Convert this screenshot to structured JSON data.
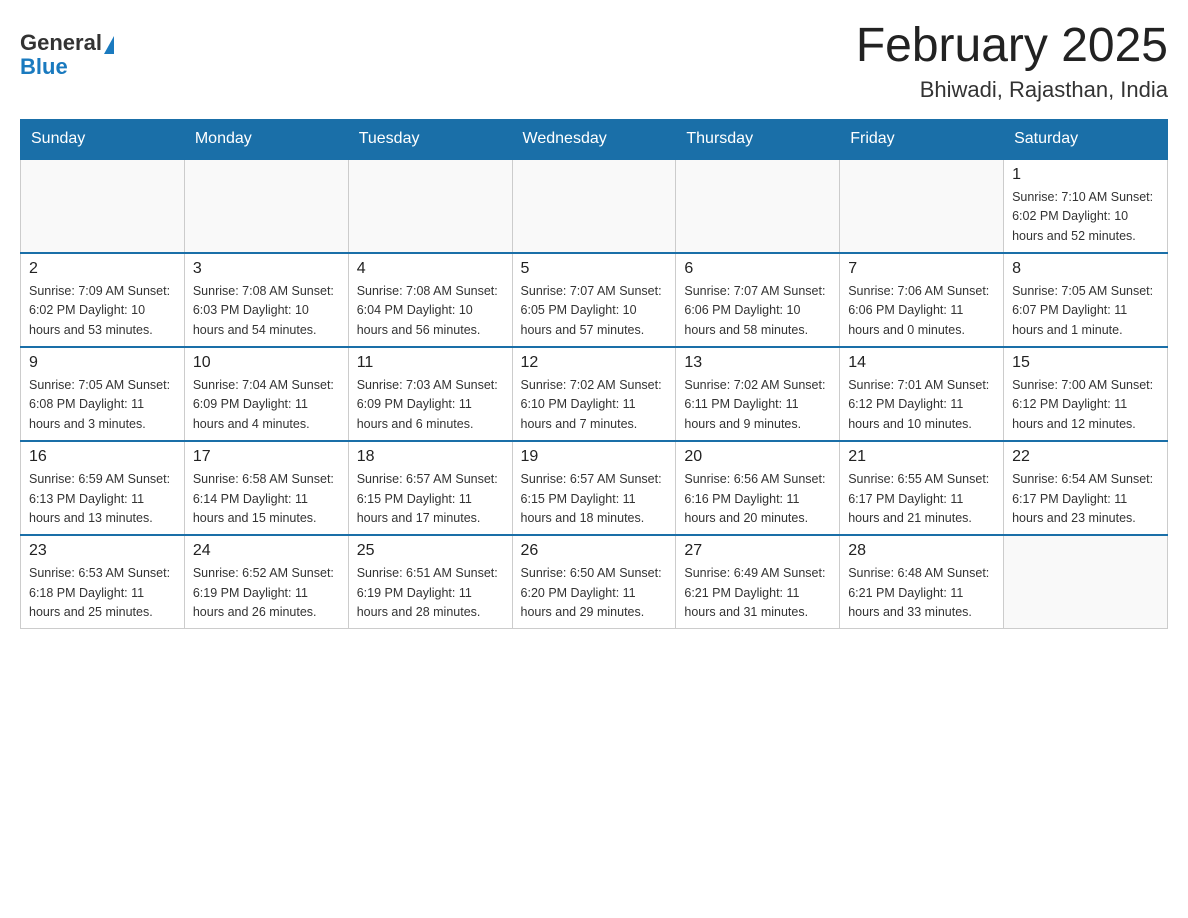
{
  "header": {
    "logo_general": "General",
    "logo_blue": "Blue",
    "title": "February 2025",
    "location": "Bhiwadi, Rajasthan, India"
  },
  "days_of_week": [
    "Sunday",
    "Monday",
    "Tuesday",
    "Wednesday",
    "Thursday",
    "Friday",
    "Saturday"
  ],
  "weeks": [
    [
      {
        "day": "",
        "info": ""
      },
      {
        "day": "",
        "info": ""
      },
      {
        "day": "",
        "info": ""
      },
      {
        "day": "",
        "info": ""
      },
      {
        "day": "",
        "info": ""
      },
      {
        "day": "",
        "info": ""
      },
      {
        "day": "1",
        "info": "Sunrise: 7:10 AM\nSunset: 6:02 PM\nDaylight: 10 hours and 52 minutes."
      }
    ],
    [
      {
        "day": "2",
        "info": "Sunrise: 7:09 AM\nSunset: 6:02 PM\nDaylight: 10 hours and 53 minutes."
      },
      {
        "day": "3",
        "info": "Sunrise: 7:08 AM\nSunset: 6:03 PM\nDaylight: 10 hours and 54 minutes."
      },
      {
        "day": "4",
        "info": "Sunrise: 7:08 AM\nSunset: 6:04 PM\nDaylight: 10 hours and 56 minutes."
      },
      {
        "day": "5",
        "info": "Sunrise: 7:07 AM\nSunset: 6:05 PM\nDaylight: 10 hours and 57 minutes."
      },
      {
        "day": "6",
        "info": "Sunrise: 7:07 AM\nSunset: 6:06 PM\nDaylight: 10 hours and 58 minutes."
      },
      {
        "day": "7",
        "info": "Sunrise: 7:06 AM\nSunset: 6:06 PM\nDaylight: 11 hours and 0 minutes."
      },
      {
        "day": "8",
        "info": "Sunrise: 7:05 AM\nSunset: 6:07 PM\nDaylight: 11 hours and 1 minute."
      }
    ],
    [
      {
        "day": "9",
        "info": "Sunrise: 7:05 AM\nSunset: 6:08 PM\nDaylight: 11 hours and 3 minutes."
      },
      {
        "day": "10",
        "info": "Sunrise: 7:04 AM\nSunset: 6:09 PM\nDaylight: 11 hours and 4 minutes."
      },
      {
        "day": "11",
        "info": "Sunrise: 7:03 AM\nSunset: 6:09 PM\nDaylight: 11 hours and 6 minutes."
      },
      {
        "day": "12",
        "info": "Sunrise: 7:02 AM\nSunset: 6:10 PM\nDaylight: 11 hours and 7 minutes."
      },
      {
        "day": "13",
        "info": "Sunrise: 7:02 AM\nSunset: 6:11 PM\nDaylight: 11 hours and 9 minutes."
      },
      {
        "day": "14",
        "info": "Sunrise: 7:01 AM\nSunset: 6:12 PM\nDaylight: 11 hours and 10 minutes."
      },
      {
        "day": "15",
        "info": "Sunrise: 7:00 AM\nSunset: 6:12 PM\nDaylight: 11 hours and 12 minutes."
      }
    ],
    [
      {
        "day": "16",
        "info": "Sunrise: 6:59 AM\nSunset: 6:13 PM\nDaylight: 11 hours and 13 minutes."
      },
      {
        "day": "17",
        "info": "Sunrise: 6:58 AM\nSunset: 6:14 PM\nDaylight: 11 hours and 15 minutes."
      },
      {
        "day": "18",
        "info": "Sunrise: 6:57 AM\nSunset: 6:15 PM\nDaylight: 11 hours and 17 minutes."
      },
      {
        "day": "19",
        "info": "Sunrise: 6:57 AM\nSunset: 6:15 PM\nDaylight: 11 hours and 18 minutes."
      },
      {
        "day": "20",
        "info": "Sunrise: 6:56 AM\nSunset: 6:16 PM\nDaylight: 11 hours and 20 minutes."
      },
      {
        "day": "21",
        "info": "Sunrise: 6:55 AM\nSunset: 6:17 PM\nDaylight: 11 hours and 21 minutes."
      },
      {
        "day": "22",
        "info": "Sunrise: 6:54 AM\nSunset: 6:17 PM\nDaylight: 11 hours and 23 minutes."
      }
    ],
    [
      {
        "day": "23",
        "info": "Sunrise: 6:53 AM\nSunset: 6:18 PM\nDaylight: 11 hours and 25 minutes."
      },
      {
        "day": "24",
        "info": "Sunrise: 6:52 AM\nSunset: 6:19 PM\nDaylight: 11 hours and 26 minutes."
      },
      {
        "day": "25",
        "info": "Sunrise: 6:51 AM\nSunset: 6:19 PM\nDaylight: 11 hours and 28 minutes."
      },
      {
        "day": "26",
        "info": "Sunrise: 6:50 AM\nSunset: 6:20 PM\nDaylight: 11 hours and 29 minutes."
      },
      {
        "day": "27",
        "info": "Sunrise: 6:49 AM\nSunset: 6:21 PM\nDaylight: 11 hours and 31 minutes."
      },
      {
        "day": "28",
        "info": "Sunrise: 6:48 AM\nSunset: 6:21 PM\nDaylight: 11 hours and 33 minutes."
      },
      {
        "day": "",
        "info": ""
      }
    ]
  ]
}
